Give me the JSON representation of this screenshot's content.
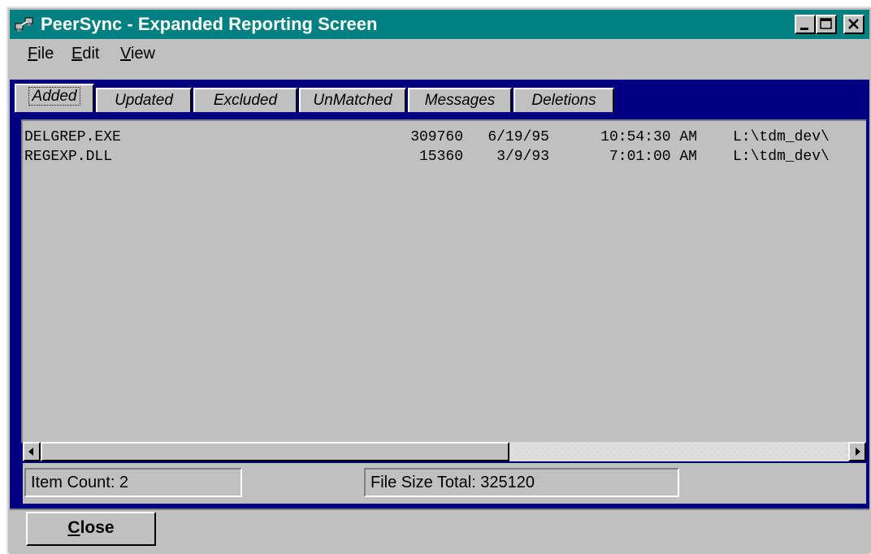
{
  "window": {
    "title": "PeerSync - Expanded Reporting Screen",
    "title_bar_color": "#008080"
  },
  "menu": {
    "items": [
      {
        "label": "File",
        "accel": "F",
        "rest": "ile"
      },
      {
        "label": "Edit",
        "accel": "E",
        "rest": "dit"
      },
      {
        "label": "View",
        "accel": "V",
        "rest": "iew"
      }
    ]
  },
  "tabs": [
    {
      "label": "Added",
      "active": true
    },
    {
      "label": "Updated",
      "active": false
    },
    {
      "label": "Excluded",
      "active": false
    },
    {
      "label": "UnMatched",
      "active": false
    },
    {
      "label": "Messages",
      "active": false
    },
    {
      "label": "Deletions",
      "active": false
    }
  ],
  "files": {
    "rows": [
      {
        "name": "DELGREP.EXE",
        "size": "309760",
        "date": "6/19/95",
        "time": "10:54:30 AM",
        "path": "L:\\tdm_dev\\"
      },
      {
        "name": "REGEXP.DLL",
        "size": "15360",
        "date": "3/9/93",
        "time": "7:01:00 AM",
        "path": "L:\\tdm_dev\\"
      }
    ]
  },
  "scrollbar": {
    "position_fraction": 0.0,
    "visible_fraction": 0.58
  },
  "status": {
    "item_count": "Item Count: 2",
    "file_size_total": "File Size Total:  325120"
  },
  "buttons": {
    "close_accel": "C",
    "close_rest": "lose"
  },
  "icons": {
    "app": "peersync-app-icon",
    "minimize": "minimize-icon",
    "maximize": "maximize-icon",
    "close": "close-icon",
    "scroll_left": "arrow-left-icon",
    "scroll_right": "arrow-right-icon"
  }
}
